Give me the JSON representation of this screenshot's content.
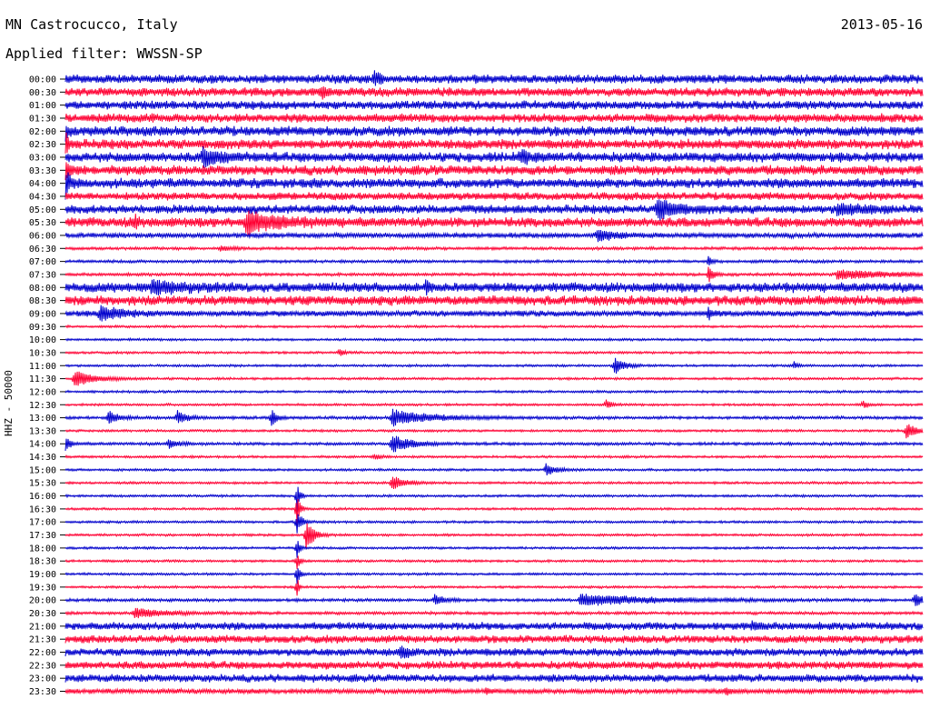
{
  "header": {
    "station": "MN Castrocucco, Italy",
    "date": "2013-05-16",
    "filter_label": "Applied filter: WWSSN-SP"
  },
  "chart_data": {
    "type": "line",
    "title": "MN Castrocucco, Italy",
    "ylabel": "HHZ - 50000",
    "colors": {
      "even_rows": "#0000cc",
      "odd_rows": "#ff0033",
      "background": "#ffffff"
    },
    "rows": [
      {
        "time": "00:00",
        "amp": 4.5,
        "events": [
          [
            0.36,
            8,
            0.005
          ]
        ]
      },
      {
        "time": "00:30",
        "amp": 4.5,
        "events": [
          [
            0.3,
            5,
            0.004
          ]
        ]
      },
      {
        "time": "01:00",
        "amp": 4.5,
        "events": []
      },
      {
        "time": "01:30",
        "amp": 4.5,
        "events": []
      },
      {
        "time": "02:00",
        "amp": 5,
        "events": [
          [
            0.0,
            8,
            0.003
          ]
        ]
      },
      {
        "time": "02:30",
        "amp": 5,
        "events": [
          [
            0.0,
            10,
            0.004
          ]
        ]
      },
      {
        "time": "03:00",
        "amp": 5,
        "events": [
          [
            0.16,
            8,
            0.02
          ],
          [
            0.53,
            7,
            0.01
          ]
        ]
      },
      {
        "time": "03:30",
        "amp": 5,
        "events": [
          [
            0.0,
            10,
            0.004
          ]
        ]
      },
      {
        "time": "04:00",
        "amp": 5,
        "events": [
          [
            0.0,
            14,
            0.005
          ]
        ]
      },
      {
        "time": "04:30",
        "amp": 4,
        "events": []
      },
      {
        "time": "05:00",
        "amp": 4.5,
        "events": [
          [
            0.69,
            10,
            0.02
          ],
          [
            0.9,
            5,
            0.03
          ]
        ]
      },
      {
        "time": "05:30",
        "amp": 5,
        "events": [
          [
            0.21,
            12,
            0.03
          ],
          [
            0.08,
            6,
            0.005
          ]
        ]
      },
      {
        "time": "06:00",
        "amp": 2.5,
        "events": [
          [
            0.62,
            6,
            0.02
          ]
        ]
      },
      {
        "time": "06:30",
        "amp": 1.5,
        "events": [
          [
            0.18,
            3,
            0.01
          ]
        ]
      },
      {
        "time": "07:00",
        "amp": 1.5,
        "events": [
          [
            0.75,
            8,
            0.003
          ]
        ]
      },
      {
        "time": "07:30",
        "amp": 1.5,
        "events": [
          [
            0.75,
            10,
            0.005
          ],
          [
            0.9,
            5,
            0.06
          ]
        ]
      },
      {
        "time": "08:00",
        "amp": 5,
        "events": [
          [
            0.1,
            6,
            0.03
          ],
          [
            0.42,
            6,
            0.005
          ]
        ]
      },
      {
        "time": "08:30",
        "amp": 5,
        "events": []
      },
      {
        "time": "09:00",
        "amp": 3,
        "events": [
          [
            0.04,
            9,
            0.02
          ],
          [
            0.75,
            8,
            0.003
          ]
        ]
      },
      {
        "time": "09:30",
        "amp": 1.2,
        "events": []
      },
      {
        "time": "10:00",
        "amp": 1.2,
        "events": []
      },
      {
        "time": "10:30",
        "amp": 1.2,
        "events": [
          [
            0.32,
            4,
            0.005
          ]
        ]
      },
      {
        "time": "11:00",
        "amp": 1.2,
        "events": [
          [
            0.64,
            10,
            0.01
          ],
          [
            0.85,
            4,
            0.004
          ]
        ]
      },
      {
        "time": "11:30",
        "amp": 1.2,
        "events": [
          [
            0.01,
            10,
            0.02
          ]
        ]
      },
      {
        "time": "12:00",
        "amp": 1.2,
        "events": []
      },
      {
        "time": "12:30",
        "amp": 1.2,
        "events": [
          [
            0.63,
            6,
            0.005
          ],
          [
            0.93,
            5,
            0.004
          ]
        ]
      },
      {
        "time": "13:00",
        "amp": 1.5,
        "events": [
          [
            0.05,
            8,
            0.01
          ],
          [
            0.13,
            8,
            0.01
          ],
          [
            0.24,
            12,
            0.005
          ],
          [
            0.38,
            9,
            0.04
          ]
        ]
      },
      {
        "time": "13:30",
        "amp": 1.2,
        "events": [
          [
            0.98,
            10,
            0.01
          ]
        ]
      },
      {
        "time": "14:00",
        "amp": 1.5,
        "events": [
          [
            0.0,
            8,
            0.005
          ],
          [
            0.12,
            5,
            0.01
          ],
          [
            0.38,
            10,
            0.02
          ]
        ]
      },
      {
        "time": "14:30",
        "amp": 1.2,
        "events": [
          [
            0.36,
            4,
            0.005
          ]
        ]
      },
      {
        "time": "15:00",
        "amp": 1.2,
        "events": [
          [
            0.56,
            8,
            0.01
          ]
        ]
      },
      {
        "time": "15:30",
        "amp": 1.2,
        "events": [
          [
            0.38,
            8,
            0.015
          ]
        ]
      },
      {
        "time": "16:00",
        "amp": 1.2,
        "events": [
          [
            0.27,
            18,
            0.003
          ]
        ]
      },
      {
        "time": "16:30",
        "amp": 1.2,
        "events": [
          [
            0.27,
            20,
            0.003
          ]
        ]
      },
      {
        "time": "17:00",
        "amp": 1.2,
        "events": [
          [
            0.27,
            14,
            0.005
          ]
        ]
      },
      {
        "time": "17:30",
        "amp": 1.2,
        "events": [
          [
            0.28,
            20,
            0.008
          ]
        ]
      },
      {
        "time": "18:00",
        "amp": 1.2,
        "events": [
          [
            0.27,
            12,
            0.003
          ]
        ]
      },
      {
        "time": "18:30",
        "amp": 1.2,
        "events": [
          [
            0.27,
            10,
            0.003
          ]
        ]
      },
      {
        "time": "19:00",
        "amp": 1.2,
        "events": [
          [
            0.27,
            12,
            0.003
          ]
        ]
      },
      {
        "time": "19:30",
        "amp": 1.2,
        "events": [
          [
            0.27,
            14,
            0.002
          ]
        ]
      },
      {
        "time": "20:00",
        "amp": 1.5,
        "events": [
          [
            0.43,
            6,
            0.01
          ],
          [
            0.6,
            6,
            0.08
          ],
          [
            0.99,
            8,
            0.01
          ]
        ]
      },
      {
        "time": "20:30",
        "amp": 1.5,
        "events": [
          [
            0.08,
            6,
            0.03
          ]
        ]
      },
      {
        "time": "21:00",
        "amp": 4,
        "events": [
          [
            0.8,
            3,
            0.01
          ]
        ]
      },
      {
        "time": "21:30",
        "amp": 4,
        "events": []
      },
      {
        "time": "22:00",
        "amp": 4,
        "events": [
          [
            0.39,
            5,
            0.01
          ]
        ]
      },
      {
        "time": "22:30",
        "amp": 4,
        "events": []
      },
      {
        "time": "23:00",
        "amp": 4,
        "events": []
      },
      {
        "time": "23:30",
        "amp": 2.5,
        "events": [
          [
            0.49,
            4,
            0.005
          ],
          [
            0.77,
            4,
            0.005
          ]
        ]
      }
    ]
  }
}
